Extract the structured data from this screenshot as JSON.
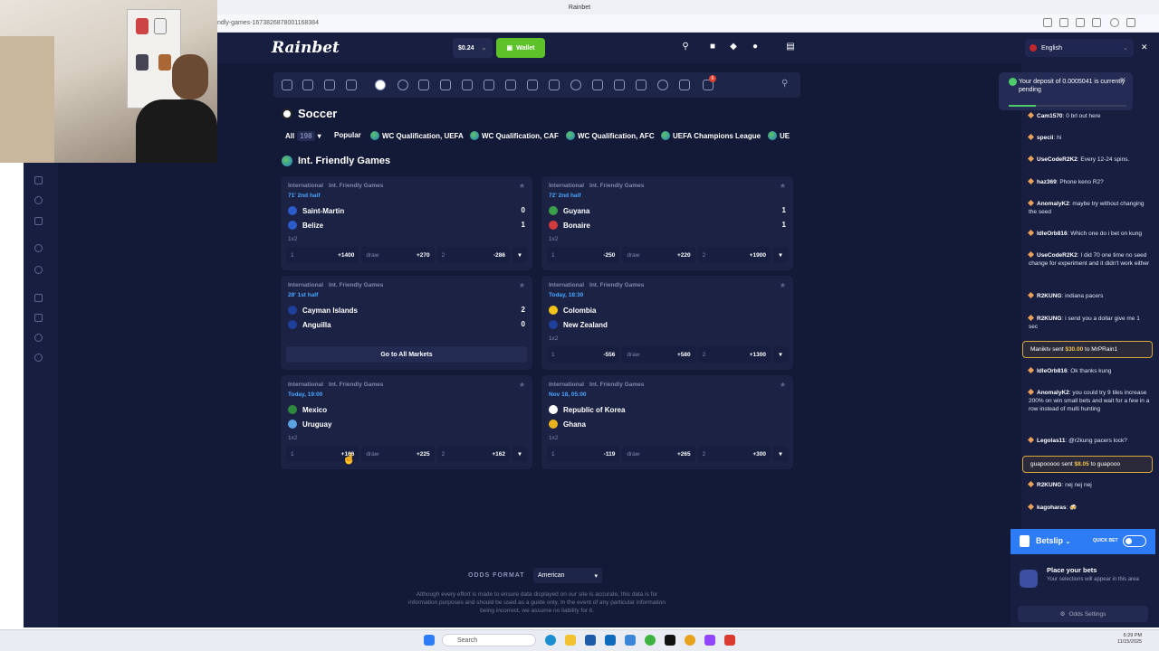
{
  "browser": {
    "tab_title": "Rainbet",
    "url": "ndly-games-1673826878001168384"
  },
  "header": {
    "logo": "Rainbet",
    "balance": "$0.24",
    "wallet_label": "Wallet",
    "gift_badge": "1",
    "notif_badge": "6"
  },
  "page": {
    "title": "Soccer",
    "filters": {
      "all_label": "All",
      "all_count": "198",
      "popular_label": "Popular",
      "leagues": [
        "WC Qualification, UEFA",
        "WC Qualification, CAF",
        "WC Qualification, AFC",
        "UEFA Champions League",
        "UE"
      ]
    },
    "section_title": "Int. Friendly Games",
    "go_all_markets": "Go to All Markets",
    "matches": [
      {
        "country": "International",
        "league": "Int. Friendly Games",
        "time": "71' 2nd half",
        "home": "Saint-Martin",
        "away": "Belize",
        "home_score": "0",
        "away_score": "1",
        "market": "1x2",
        "o1_label": "1",
        "o1": "+1400",
        "ox_label": "draw",
        "ox": "+270",
        "o2_label": "2",
        "o2": "-286",
        "home_color": "#2a5bc9",
        "away_color": "#2a5bc9"
      },
      {
        "country": "International",
        "league": "Int. Friendly Games",
        "time": "72' 2nd half",
        "home": "Guyana",
        "away": "Bonaire",
        "home_score": "1",
        "away_score": "1",
        "market": "1x2",
        "o1_label": "1",
        "o1": "-250",
        "ox_label": "draw",
        "ox": "+220",
        "o2_label": "2",
        "o2": "+1900",
        "home_color": "#3aa14a",
        "away_color": "#d23b3b"
      },
      {
        "country": "International",
        "league": "Int. Friendly Games",
        "time": "28' 1st half",
        "home": "Cayman Islands",
        "away": "Anguilla",
        "home_score": "2",
        "away_score": "0",
        "home_color": "#1e3f9a",
        "away_color": "#1e3f9a"
      },
      {
        "country": "International",
        "league": "Int. Friendly Games",
        "time": "Today, 18:30",
        "home": "Colombia",
        "away": "New Zealand",
        "market": "1x2",
        "o1_label": "1",
        "o1": "-556",
        "ox_label": "draw",
        "ox": "+580",
        "o2_label": "2",
        "o2": "+1300",
        "home_color": "#f2c418",
        "away_color": "#1e3f9a"
      },
      {
        "country": "International",
        "league": "Int. Friendly Games",
        "time": "Today, 19:00",
        "home": "Mexico",
        "away": "Uruguay",
        "market": "1x2",
        "o1_label": "1",
        "o1": "+166",
        "ox_label": "draw",
        "ox": "+225",
        "o2_label": "2",
        "o2": "+162",
        "home_color": "#2f8a3e",
        "away_color": "#5aa3e0"
      },
      {
        "country": "International",
        "league": "Int. Friendly Games",
        "time": "Nov 18, 05:00",
        "home": "Republic of Korea",
        "away": "Ghana",
        "market": "1x2",
        "o1_label": "1",
        "o1": "-119",
        "ox_label": "draw",
        "ox": "+265",
        "o2_label": "2",
        "o2": "+300",
        "home_color": "#ffffff",
        "away_color": "#e8b21b"
      }
    ],
    "odds_format_label": "ODDS FORMAT",
    "odds_format_value": "American",
    "disclaimer": "Although every effort is made to ensure data displayed on our site is accurate, this data is for information purposes and should be used as a guide only. In the event of any particular information being incorrect, we assume no liability for it."
  },
  "chat": {
    "language": "English",
    "toast": "Your deposit of 0.0005041 is currently pending",
    "messages": [
      {
        "user": "Cam1570",
        "text": "0 brl out here"
      },
      {
        "user": "specii",
        "text": "hi"
      },
      {
        "user": "UseCodeR2K2",
        "text": "Every 12-24 spins."
      },
      {
        "user": "haz369",
        "text": "Phone keno R2?"
      },
      {
        "user": "AnomalyK2",
        "text": "maybe try without changing the seed"
      },
      {
        "user": "IdleOrb816",
        "text": "Which one do i bet on kung"
      },
      {
        "user": "UseCodeR2K2",
        "text": "I did 70 one time no seed change for experiment and it didn't work either"
      },
      {
        "user": "R2KUNG",
        "text": "indiana pacers"
      },
      {
        "user": "R2KUNG",
        "text": "i send you a dollar give me 1 sec"
      },
      {
        "user": "IdleOrb816",
        "text": "Ok thanks kung"
      },
      {
        "user": "AnomalyK2",
        "text": "you could try 9 tiles increase 200% on win small bets and wait for a few in a row instead of multi hunting"
      },
      {
        "user": "Legolas11",
        "text": "@r2kung pacers lock?"
      },
      {
        "user": "R2KUNG",
        "text": "nej nej nej"
      },
      {
        "user": "kagoharas",
        "text": "🍻"
      }
    ],
    "tips": [
      {
        "from": "Maniktv",
        "word": "sent",
        "amount": "$30.00",
        "to_word": "to",
        "to": "MrPRain1"
      },
      {
        "from": "guapooooo",
        "word": "sent",
        "amount": "$8.05",
        "to_word": "to",
        "to": "guapooo"
      }
    ]
  },
  "betslip": {
    "title": "Betslip",
    "quick_bet": "QUICK BET",
    "empty_title": "Place your bets",
    "empty_text": "Your selections will appear in this area",
    "odds_settings": "Odds Settings"
  },
  "taskbar": {
    "search": "Search",
    "time": "6:29 PM",
    "date": "11/15/2025"
  }
}
